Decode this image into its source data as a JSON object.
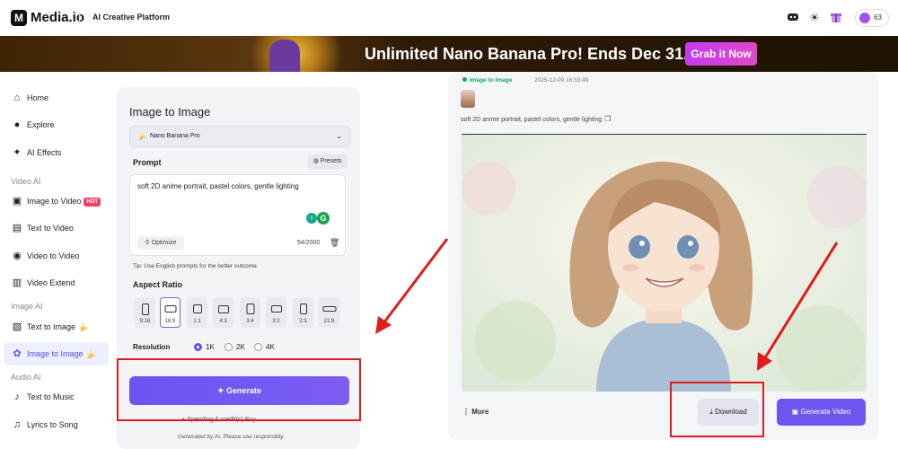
{
  "topbar": {
    "brand": "Media.io",
    "tagline": "AI Creative Platform",
    "credits": "63",
    "logo_letter": "M"
  },
  "banner": {
    "text": "Unlimited Nano Banana Pro! Ends Dec 31.",
    "cta": "Grab it Now"
  },
  "sidebar": {
    "items": [
      {
        "label": "Home",
        "icon": "home-icon"
      },
      {
        "label": "Explore",
        "icon": "compass-icon"
      },
      {
        "label": "AI Effects",
        "icon": "sparkle-icon"
      },
      {
        "label": "Image to Video",
        "icon": "image-video-icon",
        "badge": "HOT"
      },
      {
        "label": "Text to Video",
        "icon": "clapper-icon"
      },
      {
        "label": "Video to Video",
        "icon": "swap-icon"
      },
      {
        "label": "Video Extend",
        "icon": "extend-icon"
      },
      {
        "label": "Text to Image",
        "icon": "text-image-icon"
      },
      {
        "label": "Image to Image",
        "icon": "palette-icon"
      },
      {
        "label": "Text to Music",
        "icon": "music-icon"
      },
      {
        "label": "Lyrics to Song",
        "icon": "lyrics-icon"
      }
    ],
    "sections": {
      "video": "Video AI",
      "image": "Image AI",
      "audio": "Audio AI"
    }
  },
  "panel": {
    "title": "Image to Image",
    "model": "Nano Banana Pro",
    "prompt_label": "Prompt",
    "presets": "Presets",
    "prompt_value": "soft 2D anime portrait, pastel colors, gentle lighting",
    "optimize": "Optimize",
    "counter": "54/2000",
    "tip": "Tip: Use English prompts for the better outcome.",
    "aspect_label": "Aspect Ratio",
    "ratios": [
      "9:16",
      "16:9",
      "1:1",
      "4:3",
      "3:4",
      "3:2",
      "2:3",
      "21:9"
    ],
    "selected_ratio": "16:9",
    "resolution_label": "Resolution",
    "resolutions": [
      "1K",
      "2K",
      "4K"
    ],
    "selected_resolution": "1K",
    "generate": "Generate",
    "spending": "Spending 6 credit(s) Buy",
    "disclaimer": "Generated by AI. Please use responsibly."
  },
  "result": {
    "status": "Image to Image",
    "date": "2025-12-09 16:53:49",
    "prompt": "soft 2D anime portrait, pastel colors, gentle lighting",
    "more": "More",
    "download": "Download",
    "generate_video": "Generate Video"
  },
  "colors": {
    "accent": "#6f55f0",
    "annotation_red": "#e01b1b",
    "status_green": "#12a85a"
  }
}
